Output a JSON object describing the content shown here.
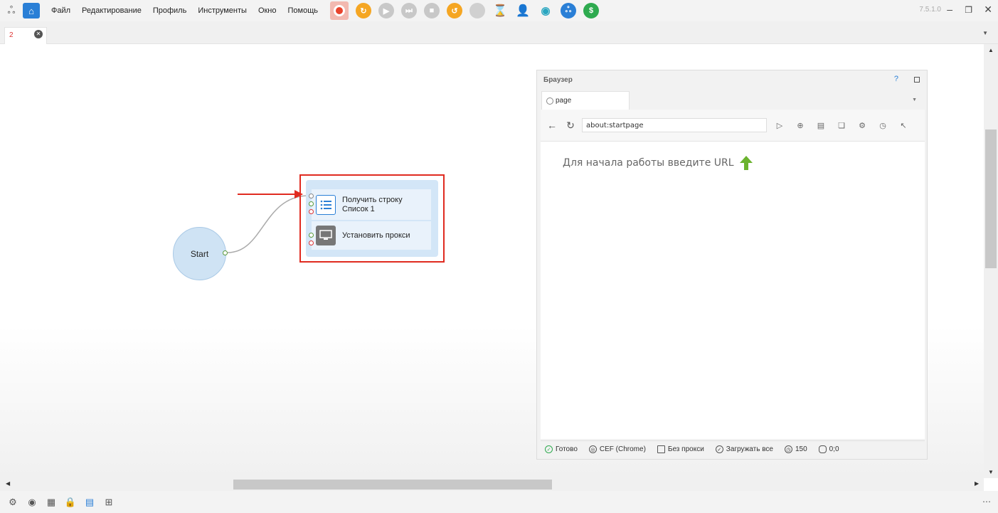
{
  "titlebar": {
    "menu": [
      "Файл",
      "Редактирование",
      "Профиль",
      "Инструменты",
      "Окно",
      "Помощь"
    ],
    "version": "7.5.1.0",
    "toolbar_icons": [
      "record-icon",
      "refresh-icon",
      "play-icon",
      "step-icon",
      "stop-icon",
      "undo-icon",
      "circle-icon",
      "hourglass-icon",
      "user-icon",
      "eye-icon",
      "share-icon",
      "dollar-icon"
    ]
  },
  "tabs": {
    "doc_tab_number": "2"
  },
  "canvas": {
    "start_label": "Start",
    "actions": [
      {
        "line1": "Получить строку",
        "line2": "Список 1"
      },
      {
        "line1": "Установить прокси",
        "line2": ""
      }
    ]
  },
  "browser": {
    "title": "Браузер",
    "help": "?",
    "tab_label": "page",
    "url": "about:startpage",
    "hint": "Для начала работы введите URL",
    "status": {
      "ready": "Готово",
      "engine": "CEF (Chrome)",
      "proxy": "Без прокси",
      "load": "Загружать все",
      "timer": "150",
      "coords": "0;0"
    }
  },
  "colors": {
    "accent": "#2a7fd6",
    "highlight": "#e02b20",
    "node_fill": "#cfe3f4",
    "hint_arrow": "#6bb32e"
  }
}
